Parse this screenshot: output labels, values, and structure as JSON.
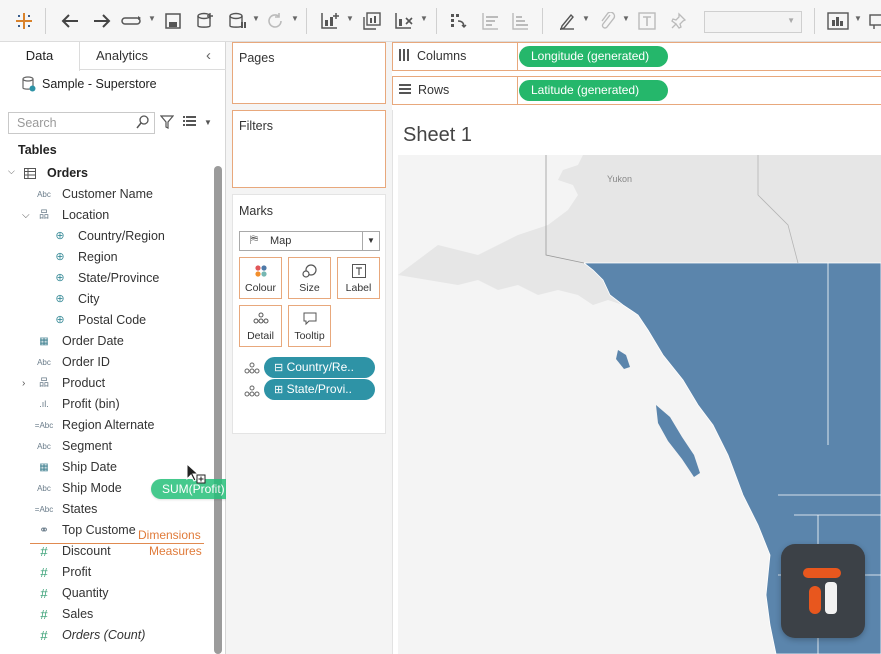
{
  "left_pane": {
    "tabs": [
      {
        "label": "Data"
      },
      {
        "label": "Analytics"
      }
    ],
    "datasource": "Sample - Superstore",
    "search_placeholder": "Search",
    "tables_heading": "Tables",
    "table_name": "Orders",
    "fields": [
      {
        "label": "Customer Name",
        "icon": "Abc"
      },
      {
        "label": "Location",
        "icon": "hierarchy"
      },
      {
        "label": "Country/Region",
        "icon": "globe"
      },
      {
        "label": "Region",
        "icon": "globe"
      },
      {
        "label": "State/Province",
        "icon": "globe"
      },
      {
        "label": "City",
        "icon": "globe"
      },
      {
        "label": "Postal Code",
        "icon": "globe"
      },
      {
        "label": "Order Date",
        "icon": "calendar"
      },
      {
        "label": "Order ID",
        "icon": "Abc"
      },
      {
        "label": "Product",
        "icon": "hierarchy"
      },
      {
        "label": "Profit (bin)",
        "icon": "bin"
      },
      {
        "label": "Region Alternate",
        "icon": "=Abc"
      },
      {
        "label": "Segment",
        "icon": "Abc"
      },
      {
        "label": "Ship Date",
        "icon": "calendar"
      },
      {
        "label": "Ship Mode",
        "icon": "Abc"
      },
      {
        "label": "States",
        "icon": "=Abc"
      },
      {
        "label": "Top Custome",
        "icon": "set"
      },
      {
        "label": "Discount",
        "icon": "#"
      },
      {
        "label": "Profit",
        "icon": "#"
      },
      {
        "label": "Quantity",
        "icon": "#"
      },
      {
        "label": "Sales",
        "icon": "#"
      },
      {
        "label": "Orders (Count)",
        "icon": "#"
      }
    ],
    "dimensions_label": "Dimensions",
    "measures_label": "Measures",
    "drag_pill": "SUM(Profit)"
  },
  "shelves": {
    "pages": "Pages",
    "filters": "Filters",
    "marks": "Marks",
    "mark_type": "Map",
    "mark_buttons": [
      {
        "label": "Colour"
      },
      {
        "label": "Size"
      },
      {
        "label": "Label"
      },
      {
        "label": "Detail"
      },
      {
        "label": "Tooltip"
      }
    ],
    "mark_pills": [
      {
        "label": "Country/Re.."
      },
      {
        "label": "State/Provi.."
      }
    ],
    "columns_label": "Columns",
    "columns_pill": "Longitude (generated)",
    "rows_label": "Rows",
    "rows_pill": "Latitude (generated)"
  },
  "sheet": {
    "title": "Sheet 1",
    "map_label": "Yukon",
    "land_color": "#e6e6e6",
    "fill_color": "#5b85ac",
    "water_color": "#f3f3f3"
  },
  "colors": {
    "accent_orange": "#e8a87c",
    "pill_green": "#25b76b",
    "pill_teal": "#2e93a6",
    "drag_green": "#25c07a"
  }
}
